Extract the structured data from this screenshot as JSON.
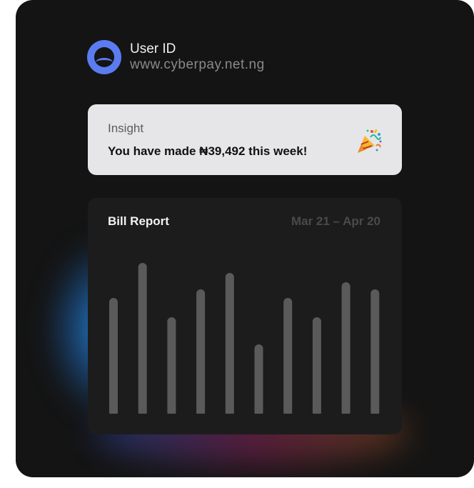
{
  "profile": {
    "user_id_label": "User ID",
    "website": "www.cyberpay.net.ng",
    "logo_icon": "cyberpay-logo-icon",
    "logo_color": "#5b7cf0"
  },
  "insight": {
    "label": "Insight",
    "message": "You have made ₦39,492 this week!",
    "icon": "party-popper-icon"
  },
  "bill_report": {
    "title": "Bill Report",
    "date_range": "Mar 21 – Apr 20"
  },
  "chart_data": {
    "type": "bar",
    "title": "Bill Report",
    "subtitle": "Mar 21 – Apr 20",
    "categories": [],
    "values": [
      162,
      211,
      135,
      174,
      197,
      97,
      162,
      135,
      184,
      174
    ],
    "bar_color": "#5a5a5a",
    "ylim": [
      0,
      215
    ],
    "grid": false
  }
}
